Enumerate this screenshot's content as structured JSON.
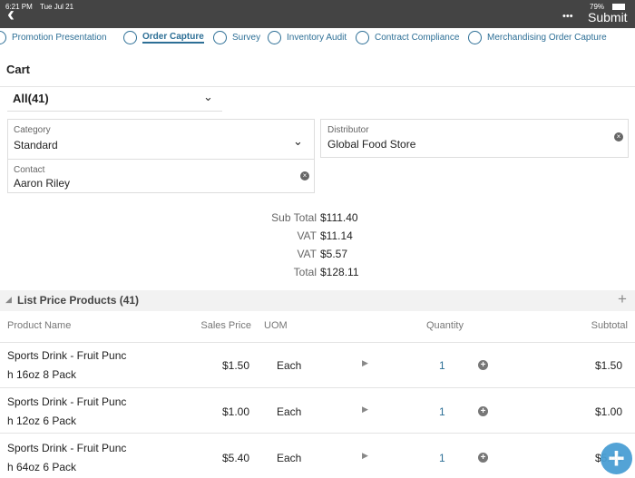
{
  "status": {
    "time": "6:21 PM",
    "date": "Tue Jul 21",
    "battery": "79%"
  },
  "header": {
    "back_icon": "chevron-left",
    "more": "•••",
    "submit": "Submit"
  },
  "tabs": [
    {
      "label": "Promotion Presentation"
    },
    {
      "label": "Order Capture",
      "active": true
    },
    {
      "label": "Survey"
    },
    {
      "label": "Inventory Audit"
    },
    {
      "label": "Contract Compliance"
    },
    {
      "label": "Merchandising Order Capture"
    }
  ],
  "cart": {
    "title": "Cart",
    "filter": "All(41)"
  },
  "fields": {
    "category_label": "Category",
    "category_value": "Standard",
    "distributor_label": "Distributor",
    "distributor_value": "Global Food Store",
    "contact_label": "Contact",
    "contact_value": "Aaron Riley"
  },
  "totals": [
    {
      "label": "Sub Total",
      "value": "$111.40"
    },
    {
      "label": "VAT",
      "value": "$11.14"
    },
    {
      "label": "VAT",
      "value": "$5.57"
    },
    {
      "label": "Total",
      "value": "$128.11"
    }
  ],
  "section": {
    "title": "List Price Products (41)"
  },
  "columns": {
    "name": "Product Name",
    "price": "Sales Price",
    "uom": "UOM",
    "qty": "Quantity",
    "subtotal": "Subtotal"
  },
  "rows": [
    {
      "name1": "Sports Drink - Fruit Punc",
      "name2": "h 16oz 8 Pack",
      "price": "$1.50",
      "uom": "Each",
      "qty": "1",
      "subtotal": "$1.50"
    },
    {
      "name1": "Sports Drink - Fruit Punc",
      "name2": "h 12oz 6 Pack",
      "price": "$1.00",
      "uom": "Each",
      "qty": "1",
      "subtotal": "$1.00"
    },
    {
      "name1": "Sports Drink - Fruit Punc",
      "name2": "h 64oz 6 Pack",
      "price": "$5.40",
      "uom": "Each",
      "qty": "1",
      "subtotal": "$5.40"
    }
  ],
  "colors": {
    "accent": "#2d6f96",
    "topbar": "#444444",
    "fab": "#4a9fd4"
  }
}
